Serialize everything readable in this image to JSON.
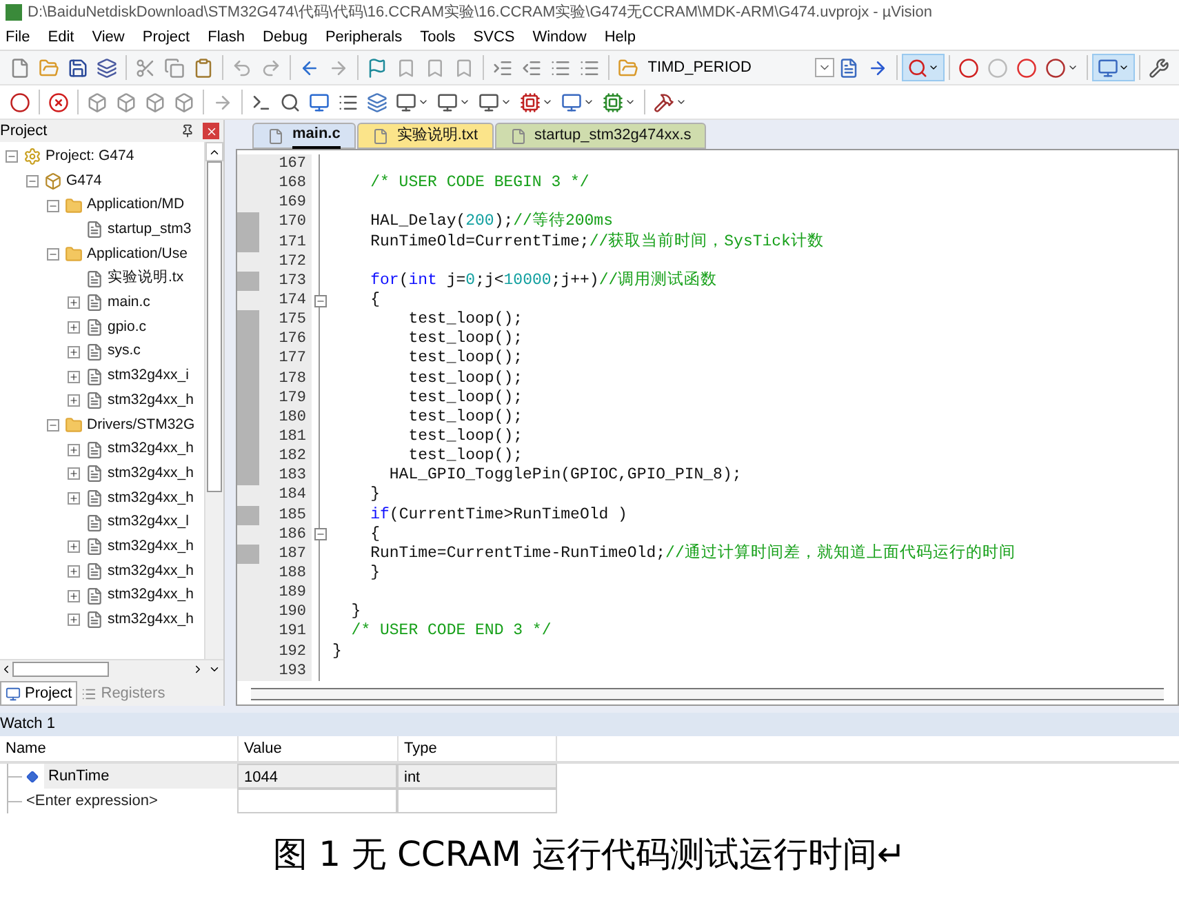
{
  "window": {
    "title": "D:\\BaiduNetdiskDownload\\STM32G474\\代码\\代码\\16.CCRAM实验\\16.CCRAM实验\\G474无CCRAM\\MDK-ARM\\G474.uvprojx - µVision"
  },
  "menu": [
    "File",
    "Edit",
    "View",
    "Project",
    "Flash",
    "Debug",
    "Peripherals",
    "Tools",
    "SVCS",
    "Window",
    "Help"
  ],
  "target_field": {
    "value": "TIMD_PERIOD"
  },
  "project_panel": {
    "title": "Project",
    "tree": [
      {
        "label": "Project: G474",
        "kind": "project",
        "expanded": true,
        "children": [
          {
            "label": "G474",
            "kind": "target",
            "expanded": true,
            "children": [
              {
                "label": "Application/MD",
                "kind": "folder",
                "expanded": true,
                "children": [
                  {
                    "label": "startup_stm3",
                    "kind": "file"
                  }
                ]
              },
              {
                "label": "Application/Use",
                "kind": "folder",
                "expanded": true,
                "children": [
                  {
                    "label": "实验说明.tx",
                    "kind": "file"
                  },
                  {
                    "label": "main.c",
                    "kind": "file",
                    "expanded": false
                  },
                  {
                    "label": "gpio.c",
                    "kind": "file",
                    "expanded": false
                  },
                  {
                    "label": "sys.c",
                    "kind": "file",
                    "expanded": false
                  },
                  {
                    "label": "stm32g4xx_i",
                    "kind": "file",
                    "expanded": false
                  },
                  {
                    "label": "stm32g4xx_h",
                    "kind": "file",
                    "expanded": false
                  }
                ]
              },
              {
                "label": "Drivers/STM32G",
                "kind": "folder",
                "expanded": true,
                "children": [
                  {
                    "label": "stm32g4xx_h",
                    "kind": "file",
                    "expanded": false
                  },
                  {
                    "label": "stm32g4xx_h",
                    "kind": "file",
                    "expanded": false
                  },
                  {
                    "label": "stm32g4xx_h",
                    "kind": "file",
                    "expanded": false
                  },
                  {
                    "label": "stm32g4xx_l",
                    "kind": "file"
                  },
                  {
                    "label": "stm32g4xx_h",
                    "kind": "file",
                    "expanded": false
                  },
                  {
                    "label": "stm32g4xx_h",
                    "kind": "file",
                    "expanded": false
                  },
                  {
                    "label": "stm32g4xx_h",
                    "kind": "file",
                    "expanded": false
                  },
                  {
                    "label": "stm32g4xx_h",
                    "kind": "file",
                    "expanded": false
                  }
                ]
              }
            ]
          }
        ]
      }
    ],
    "tabs": [
      {
        "label": "Project",
        "selected": true
      },
      {
        "label": "Registers",
        "selected": false
      }
    ]
  },
  "editor_tabs": [
    {
      "label": "main.c",
      "selected": true,
      "color": "#d6e2f3"
    },
    {
      "label": "实验说明.txt",
      "selected": false,
      "color": "#fbe48a"
    },
    {
      "label": "startup_stm32g474xx.s",
      "selected": false,
      "color": "#cfdcad"
    }
  ],
  "code_lines": [
    {
      "number": "167",
      "marked": false,
      "foldable": false
    },
    {
      "number": "168",
      "marked": false,
      "foldable": false,
      "segments": [
        {
          "kind": "comment",
          "text": "    /* USER CODE BEGIN 3 */"
        }
      ]
    },
    {
      "number": "169",
      "marked": false,
      "foldable": false
    },
    {
      "number": "170",
      "marked": true,
      "foldable": false,
      "segments": [
        {
          "kind": "plain",
          "text": "    HAL_Delay("
        },
        {
          "kind": "number",
          "text": "200"
        },
        {
          "kind": "plain",
          "text": ");"
        },
        {
          "kind": "comment",
          "text": "//等待200ms"
        }
      ]
    },
    {
      "number": "171",
      "marked": true,
      "foldable": false,
      "segments": [
        {
          "kind": "plain",
          "text": "    RunTimeOld=CurrentTime;"
        },
        {
          "kind": "comment",
          "text": "//获取当前时间，SysTick计数"
        }
      ]
    },
    {
      "number": "172",
      "marked": false,
      "foldable": false
    },
    {
      "number": "173",
      "marked": true,
      "foldable": false,
      "segments": [
        {
          "kind": "keyword",
          "text": "    for"
        },
        {
          "kind": "plain",
          "text": "("
        },
        {
          "kind": "keyword",
          "text": "int"
        },
        {
          "kind": "plain",
          "text": " j="
        },
        {
          "kind": "number",
          "text": "0"
        },
        {
          "kind": "plain",
          "text": ";j<"
        },
        {
          "kind": "number",
          "text": "10000"
        },
        {
          "kind": "plain",
          "text": ";j++)"
        },
        {
          "kind": "comment",
          "text": "//调用测试函数"
        }
      ]
    },
    {
      "number": "174",
      "marked": false,
      "foldable": true,
      "segments": [
        {
          "kind": "plain",
          "text": "    {"
        }
      ]
    },
    {
      "number": "175",
      "marked": true,
      "foldable": false,
      "segments": [
        {
          "kind": "plain",
          "text": "        test_loop();"
        }
      ]
    },
    {
      "number": "176",
      "marked": true,
      "foldable": false,
      "segments": [
        {
          "kind": "plain",
          "text": "        test_loop();"
        }
      ]
    },
    {
      "number": "177",
      "marked": true,
      "foldable": false,
      "segments": [
        {
          "kind": "plain",
          "text": "        test_loop();"
        }
      ]
    },
    {
      "number": "178",
      "marked": true,
      "foldable": false,
      "segments": [
        {
          "kind": "plain",
          "text": "        test_loop();"
        }
      ]
    },
    {
      "number": "179",
      "marked": true,
      "foldable": false,
      "segments": [
        {
          "kind": "plain",
          "text": "        test_loop();"
        }
      ]
    },
    {
      "number": "180",
      "marked": true,
      "foldable": false,
      "segments": [
        {
          "kind": "plain",
          "text": "        test_loop();"
        }
      ]
    },
    {
      "number": "181",
      "marked": true,
      "foldable": false,
      "segments": [
        {
          "kind": "plain",
          "text": "        test_loop();"
        }
      ]
    },
    {
      "number": "182",
      "marked": true,
      "foldable": false,
      "segments": [
        {
          "kind": "plain",
          "text": "        test_loop();"
        }
      ]
    },
    {
      "number": "183",
      "marked": true,
      "foldable": false,
      "segments": [
        {
          "kind": "plain",
          "text": "      HAL_GPIO_TogglePin(GPIOC,GPIO_PIN_8);"
        }
      ]
    },
    {
      "number": "184",
      "marked": false,
      "foldable": false,
      "segments": [
        {
          "kind": "plain",
          "text": "    }"
        }
      ]
    },
    {
      "number": "185",
      "marked": true,
      "foldable": false,
      "segments": [
        {
          "kind": "keyword",
          "text": "    if"
        },
        {
          "kind": "plain",
          "text": "(CurrentTime>RunTimeOld )"
        }
      ]
    },
    {
      "number": "186",
      "marked": false,
      "foldable": true,
      "segments": [
        {
          "kind": "plain",
          "text": "    {"
        }
      ]
    },
    {
      "number": "187",
      "marked": true,
      "foldable": false,
      "segments": [
        {
          "kind": "plain",
          "text": "    RunTime=CurrentTime-RunTimeOld;"
        },
        {
          "kind": "comment",
          "text": "//通过计算时间差，就知道上面代码运行的时间"
        }
      ]
    },
    {
      "number": "188",
      "marked": false,
      "foldable": false,
      "segments": [
        {
          "kind": "plain",
          "text": "    }"
        }
      ]
    },
    {
      "number": "189",
      "marked": false,
      "foldable": false
    },
    {
      "number": "190",
      "marked": false,
      "foldable": false,
      "segments": [
        {
          "kind": "plain",
          "text": "  }"
        }
      ]
    },
    {
      "number": "191",
      "marked": false,
      "foldable": false,
      "segments": [
        {
          "kind": "comment",
          "text": "  /* USER CODE END 3 */"
        }
      ]
    },
    {
      "number": "192",
      "marked": false,
      "foldable": false,
      "segments": [
        {
          "kind": "plain",
          "text": "}"
        }
      ]
    },
    {
      "number": "193",
      "marked": false,
      "foldable": false
    }
  ],
  "watch": {
    "title": "Watch 1",
    "columns": [
      "Name",
      "Value",
      "Type"
    ],
    "rows": [
      {
        "name": "RunTime",
        "value": "1044",
        "type": "int",
        "kind": "variable"
      },
      {
        "name": "<Enter expression>",
        "kind": "placeholder"
      }
    ]
  },
  "caption": "图 1 无 CCRAM 运行代码测试运行时间↵"
}
